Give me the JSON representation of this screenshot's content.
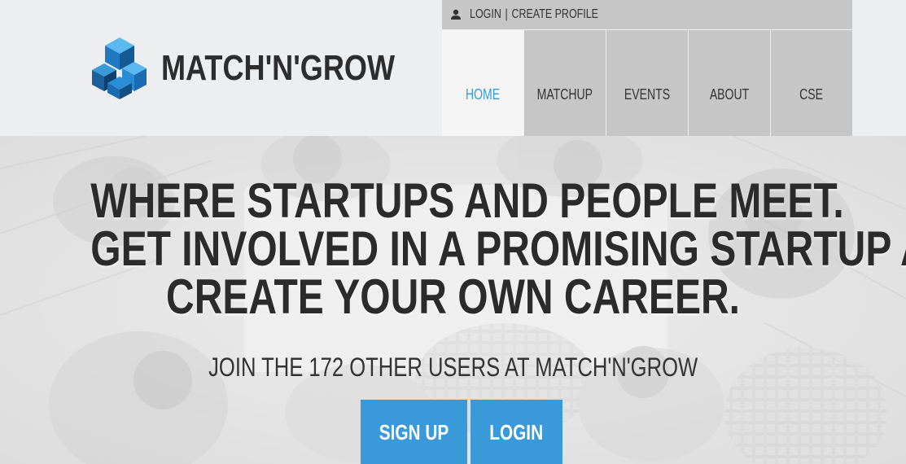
{
  "brand": {
    "name": "MATCH'N'GROW",
    "accent_color": "#3a9ad9",
    "logo_icon": "cube-stack-logo-icon"
  },
  "account_bar": {
    "icon": "user-icon",
    "login_label": "LOGIN",
    "separator": "|",
    "create_profile_label": "CREATE PROFILE"
  },
  "nav": {
    "items": [
      {
        "label": "HOME",
        "active": true
      },
      {
        "label": "MATCHUP",
        "active": false
      },
      {
        "label": "EVENTS",
        "active": false
      },
      {
        "label": "ABOUT",
        "active": false
      },
      {
        "label": "CSE",
        "active": false
      }
    ]
  },
  "hero": {
    "headline": [
      "WHERE STARTUPS AND PEOPLE MEET.",
      "GET INVOLVED IN A PROMISING STARTUP AND",
      "CREATE YOUR OWN CAREER."
    ],
    "subline": "JOIN THE 172 OTHER USERS AT MATCH'N'GROW",
    "signup_label": "SIGN UP",
    "login_label": "LOGIN"
  }
}
